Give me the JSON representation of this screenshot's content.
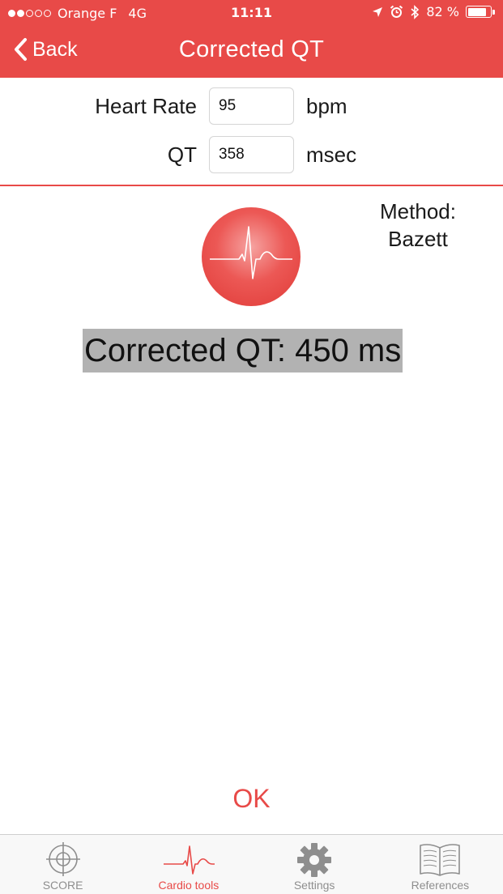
{
  "status_bar": {
    "carrier": "Orange F",
    "network": "4G",
    "time": "11:11",
    "battery_percent": "82 %",
    "battery_level": 0.82,
    "signal_bars_filled": 2,
    "signal_bars_total": 5
  },
  "nav": {
    "back_label": "Back",
    "title": "Corrected QT"
  },
  "form": {
    "heart_rate": {
      "label": "Heart Rate",
      "value": "95",
      "unit": "bpm"
    },
    "qt": {
      "label": "QT",
      "value": "358",
      "unit": "msec"
    }
  },
  "result": {
    "method_label": "Method:",
    "method_value": "Bazett",
    "corrected_qt_text": "Corrected QT: 450 ms"
  },
  "ok_label": "OK",
  "tabs": [
    {
      "label": "SCORE",
      "icon": "crosshair-icon",
      "active": false
    },
    {
      "label": "Cardio tools",
      "icon": "ecg-wave-icon",
      "active": true
    },
    {
      "label": "Settings",
      "icon": "gear-icon",
      "active": false
    },
    {
      "label": "References",
      "icon": "open-book-icon",
      "active": false
    }
  ],
  "colors": {
    "accent": "#e84a48",
    "result_highlight": "#b2b2b2",
    "tab_inactive": "#8e8e8e"
  }
}
